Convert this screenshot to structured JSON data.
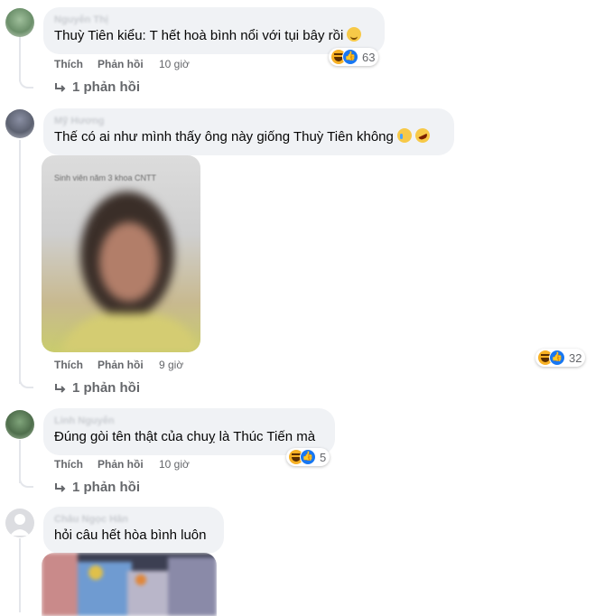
{
  "comments": [
    {
      "author": "Nguyễn Thị",
      "text": "Thuỳ Tiên kiểu: T hết hoà bình nổi với tụi bây rồi",
      "actions": {
        "like": "Thích",
        "reply": "Phản hồi",
        "time": "10 giờ"
      },
      "reaction_count": "63",
      "replies_label": "1 phản hồi"
    },
    {
      "author": "Mỹ Hương",
      "text": "Thế có ai như mình thấy ông này giống Thuỳ Tiên không",
      "photo_caption": "Sinh viên năm 3 khoa CNTT",
      "actions": {
        "like": "Thích",
        "reply": "Phản hồi",
        "time": "9 giờ"
      },
      "reaction_count": "32",
      "replies_label": "1 phản hồi"
    },
    {
      "author": "Linh Nguyễn",
      "text": "Đúng gòi tên thật của chuỵ là Thúc Tiến mà",
      "actions": {
        "like": "Thích",
        "reply": "Phản hồi",
        "time": "10 giờ"
      },
      "reaction_count": "5",
      "replies_label": "1 phản hồi"
    },
    {
      "author": "Châu Ngọc Hân",
      "text": "hỏi câu hết hòa bình luôn"
    }
  ],
  "colors": {
    "bubble": "#f0f2f5",
    "meta": "#65676b",
    "like_blue": "#1877f2",
    "haha_yellow": "#f7b125"
  },
  "icons": {
    "reply": "reply-arrow-icon",
    "haha": "haha-reaction-icon",
    "like": "like-reaction-icon"
  }
}
